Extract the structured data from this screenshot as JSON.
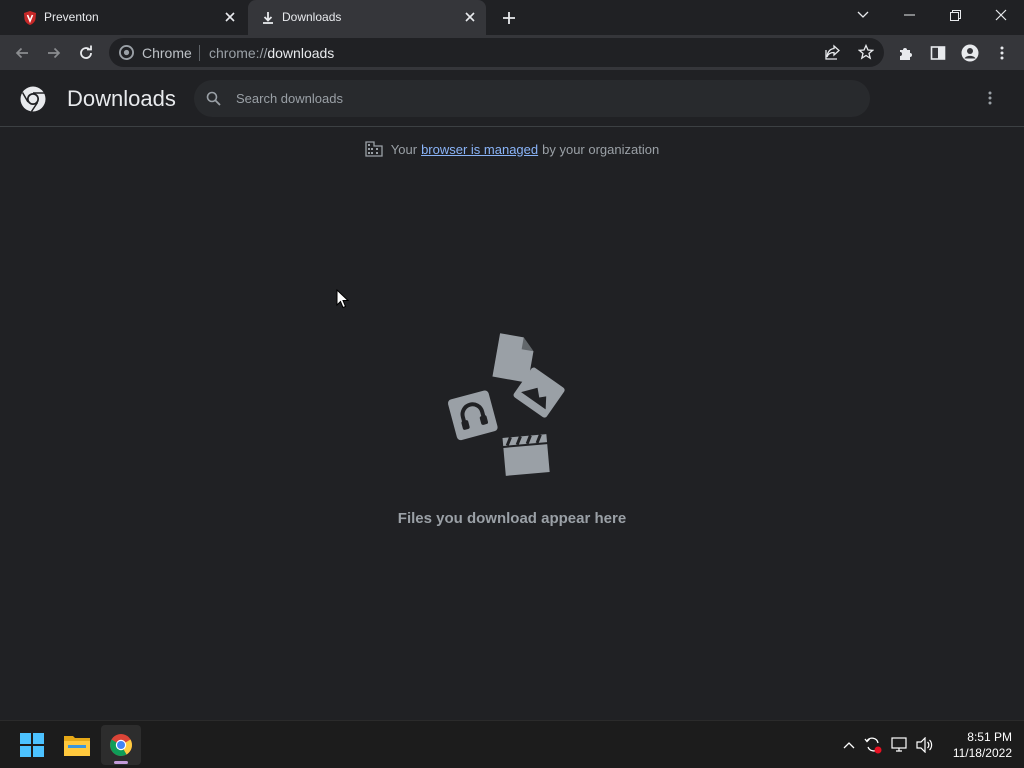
{
  "tabs": [
    {
      "title": "Preventon",
      "icon": "preventon-shield-icon",
      "active": false
    },
    {
      "title": "Downloads",
      "icon": "download-icon",
      "active": true
    }
  ],
  "omnibox": {
    "chip": "Chrome",
    "url_prefix": "chrome://",
    "url_host": "downloads"
  },
  "page": {
    "title": "Downloads",
    "search_placeholder": "Search downloads",
    "managed_prefix": "Your",
    "managed_link": "browser is managed",
    "managed_suffix": "by your organization",
    "empty_text": "Files you download appear here"
  },
  "taskbar": {
    "apps": [
      "windows-start-icon",
      "file-explorer-icon",
      "chrome-icon"
    ],
    "time": "8:51 PM",
    "date": "11/18/2022"
  },
  "colors": {
    "background": "#202124",
    "toolbar": "#35363a",
    "link": "#8ab4f8",
    "text_secondary": "#9aa0a6",
    "illustration": "#9aa0a6"
  }
}
